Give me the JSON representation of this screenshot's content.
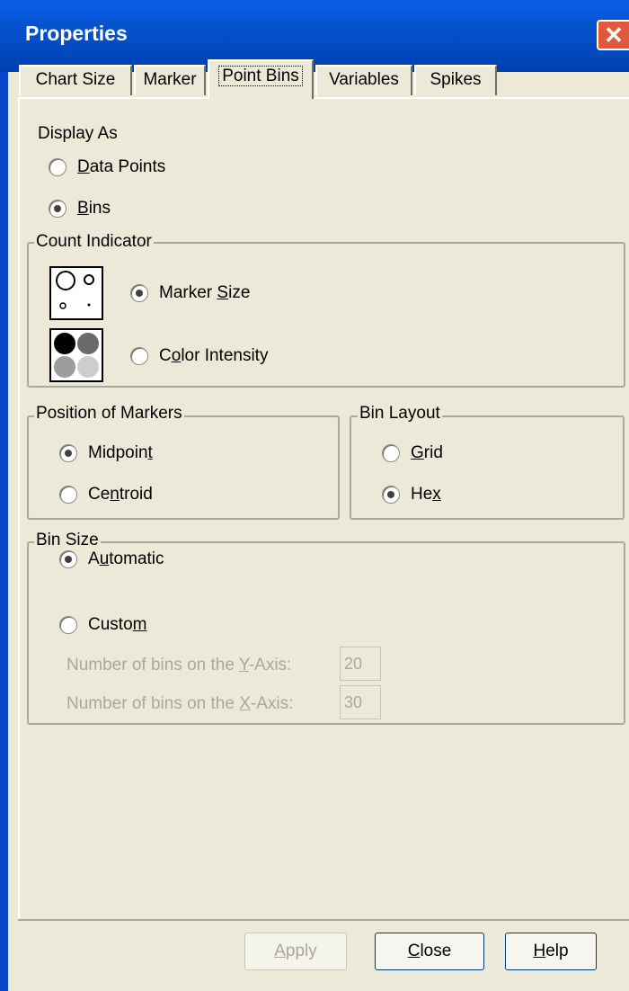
{
  "window": {
    "title": "Properties",
    "close_glyph": "✕"
  },
  "tabs": [
    {
      "label": "Chart Size",
      "active": false
    },
    {
      "label": "Marker",
      "active": false
    },
    {
      "label": "Point Bins",
      "active": true
    },
    {
      "label": "Variables",
      "active": false
    },
    {
      "label": "Spikes",
      "active": false
    }
  ],
  "display_as": {
    "label": "Display As",
    "options": [
      {
        "pre": "",
        "key": "D",
        "post": "ata Points",
        "selected": false
      },
      {
        "pre": "",
        "key": "B",
        "post": "ins",
        "selected": true
      }
    ]
  },
  "count_indicator": {
    "legend": "Count Indicator",
    "options": [
      {
        "pre": "Marker ",
        "key": "S",
        "post": "ize",
        "selected": true,
        "icon": "marker-size-icon"
      },
      {
        "pre": "C",
        "key": "o",
        "post": "lor Intensity",
        "selected": false,
        "icon": "color-intensity-icon"
      }
    ]
  },
  "position_of_markers": {
    "legend": "Position of Markers",
    "options": [
      {
        "pre": "Midpoin",
        "key": "t",
        "post": "",
        "selected": true
      },
      {
        "pre": "Ce",
        "key": "n",
        "post": "troid",
        "selected": false
      }
    ]
  },
  "bin_layout": {
    "legend": "Bin Layout",
    "options": [
      {
        "pre": "",
        "key": "G",
        "post": "rid",
        "selected": false
      },
      {
        "pre": "He",
        "key": "x",
        "post": "",
        "selected": true
      }
    ]
  },
  "bin_size": {
    "legend": "Bin Size",
    "options": [
      {
        "pre": "A",
        "key": "u",
        "post": "tomatic",
        "selected": true
      },
      {
        "pre": "Custo",
        "key": "m",
        "post": "",
        "selected": false
      }
    ],
    "y_bins": {
      "pre": "Number of bins on the ",
      "key": "Y",
      "post": "-Axis:",
      "value": "20"
    },
    "x_bins": {
      "pre": "Number of bins on the ",
      "key": "X",
      "post": "-Axis:",
      "value": "30"
    }
  },
  "buttons": {
    "apply": {
      "key": "A",
      "post": "pply",
      "enabled": false
    },
    "close": {
      "key": "C",
      "post": "lose",
      "enabled": true
    },
    "help": {
      "key": "H",
      "post": "elp",
      "enabled": true
    }
  },
  "colors": {
    "titlebar": "#0653cf",
    "dialog_bg": "#ece9d8",
    "disabled_text": "#aca899"
  }
}
